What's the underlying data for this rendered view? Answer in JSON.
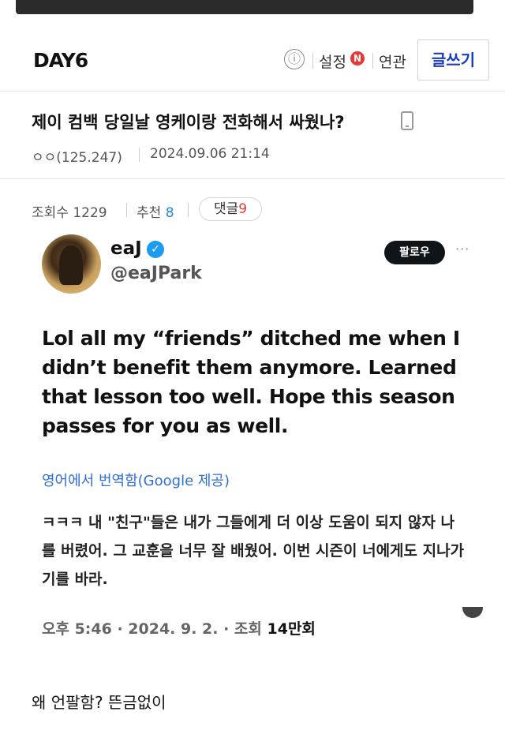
{
  "header": {
    "board_name": "DAY6",
    "info_icon": "ⓘ",
    "settings_label": "설정",
    "settings_badge": "N",
    "related_label": "연관",
    "write_label": "글쓰기"
  },
  "post": {
    "title": "제이 컴백 당일날 영케이랑 전화해서 싸웠나?",
    "author": "ㅇㅇ(125.247)",
    "datetime": "2024.09.06 21:14",
    "views_label": "조회수 1229",
    "recommend_label": "추천",
    "recommend_count": "8",
    "comments_label": "댓글",
    "comments_count": "9"
  },
  "tweet": {
    "display_name": "eaJ",
    "handle": "@eaJPark",
    "follow_label": "팔로우",
    "more_label": "···",
    "text": "Lol all my “friends” ditched me when I didn’t benefit them anymore. Learned that lesson too well. Hope this season passes for you as well.",
    "translated_label": "영어에서 번역함(Google 제공)",
    "translated_text": "ㅋㅋㅋ 내 \"친구\"들은 내가 그들에게 더 이상 도움이 되지 않자 나를 버렸어. 그 교훈을 너무 잘 배웠어. 이번 시즌이 너에게도 지나가기를 바라.",
    "timestamp": "오후 5:46 · 2024. 9. 2. · 조회 ",
    "view_count": "14만회"
  },
  "body_text": "왜 언팔함? 뜬금없이",
  "colors": {
    "accent_blue": "#1a3cbf",
    "badge_red": "#e53935",
    "verified_blue": "#1d9bf0",
    "recommend_blue": "#1e88e5"
  },
  "icons": {
    "info": "info-icon",
    "phone": "mobile-phone-icon",
    "verified": "verified-badge-icon"
  }
}
